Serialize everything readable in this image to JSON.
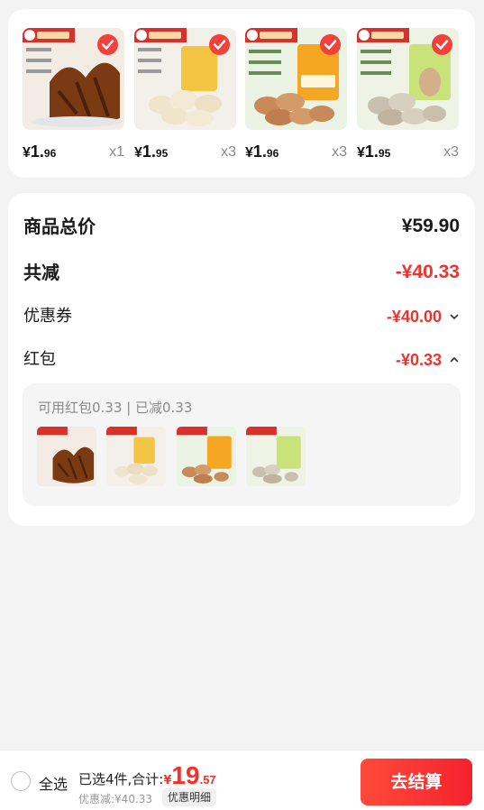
{
  "products": [
    {
      "price_symbol": "¥",
      "price_int": "1.",
      "price_dec": "96",
      "qty": "x1",
      "name": "beef-jerky",
      "colors": {
        "bg": "#f2ece4",
        "food": "#7a3b12",
        "pkg": "#ffffff"
      }
    },
    {
      "price_symbol": "¥",
      "price_int": "1.",
      "price_dec": "95",
      "qty": "x3",
      "name": "cashews",
      "colors": {
        "bg": "#f3f0ea",
        "food": "#efe4cc",
        "pkg": "#f4c542"
      }
    },
    {
      "price_symbol": "¥",
      "price_int": "1.",
      "price_dec": "96",
      "qty": "x3",
      "name": "brazil-nuts",
      "colors": {
        "bg": "#eaf3e4",
        "food": "#c98a5a",
        "pkg": "#f5a623"
      }
    },
    {
      "price_symbol": "¥",
      "price_int": "1.",
      "price_dec": "95",
      "qty": "x3",
      "name": "almonds",
      "colors": {
        "bg": "#eef3e6",
        "food": "#c9bfae",
        "pkg": "#c9e27a"
      }
    }
  ],
  "summary": {
    "total_label": "商品总价",
    "total_value": "¥59.90",
    "reduce_label": "共减",
    "reduce_value": "-¥40.33",
    "coupon_label": "优惠券",
    "coupon_value": "-¥40.00",
    "redpack_label": "红包",
    "redpack_value": "-¥0.33",
    "redpack_info": "可用红包0.33 | 已减0.33"
  },
  "bottom": {
    "select_all": "全选",
    "selected_text": "已选4件,合计:",
    "currency": "¥",
    "amount_int": "19",
    "amount_dec": ".57",
    "discount_text": "优惠减:¥40.33",
    "detail_button": "优惠明细",
    "checkout_button": "去结算"
  },
  "colors": {
    "accent": "#f0322d",
    "check": "#f2403a"
  }
}
